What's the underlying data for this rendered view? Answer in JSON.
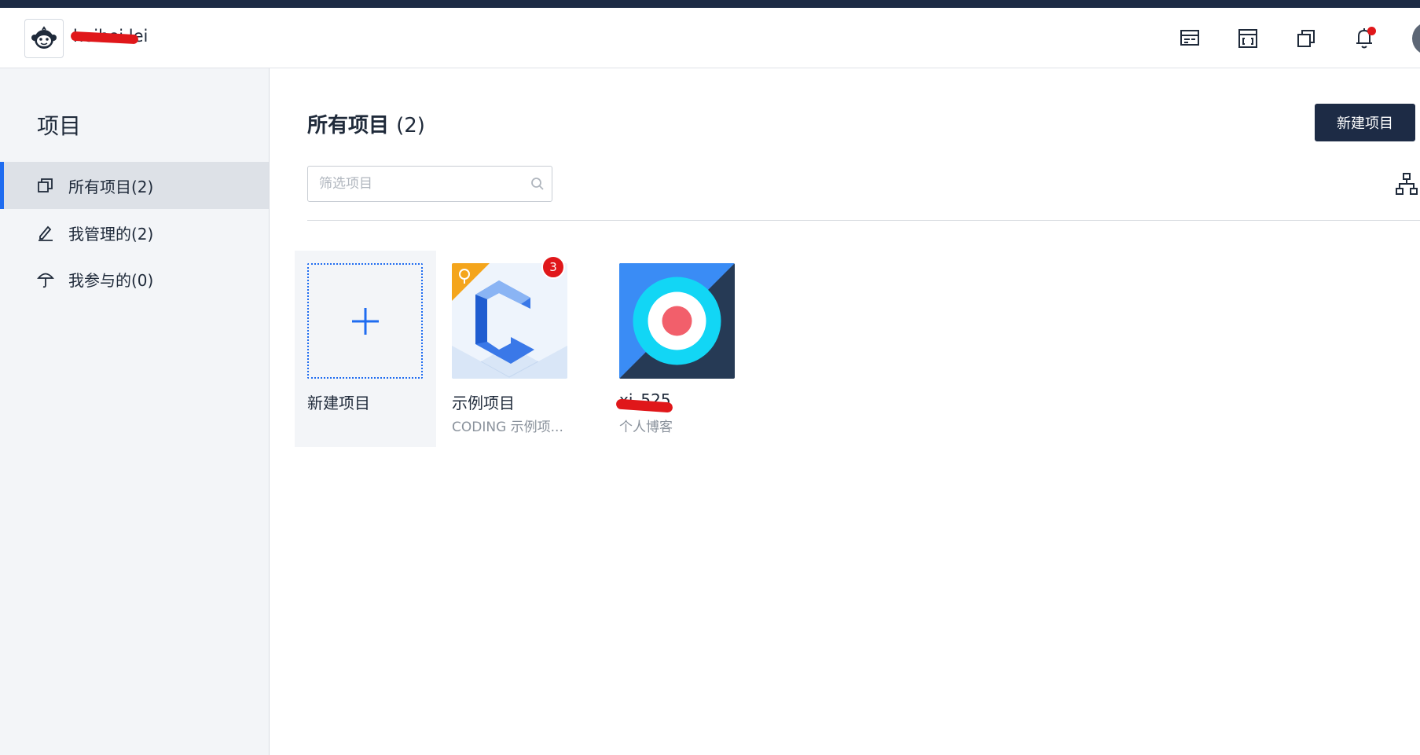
{
  "header": {
    "team_name": "heihei.lei",
    "icons": [
      "workspace-icon",
      "dashboard-icon",
      "projects-icon",
      "bell-icon"
    ]
  },
  "sidebar": {
    "title": "项目",
    "items": [
      {
        "label": "所有项目(2)",
        "icon": "copy-icon"
      },
      {
        "label": "我管理的(2)",
        "icon": "pencil-icon"
      },
      {
        "label": "我参与的(0)",
        "icon": "umbrella-icon"
      }
    ]
  },
  "main": {
    "title": "所有项目",
    "count": "(2)",
    "new_button": "新建项目",
    "search_placeholder": "筛选项目",
    "projects": [
      {
        "name": "新建项目"
      },
      {
        "name": "示例项目",
        "desc": "CODING 示例项...",
        "badge": "3"
      },
      {
        "name": "xj_525",
        "desc": "个人博客"
      }
    ]
  },
  "colors": {
    "accent": "#1f6cf0",
    "dark": "#1d2b45",
    "alert": "#e0171a"
  }
}
